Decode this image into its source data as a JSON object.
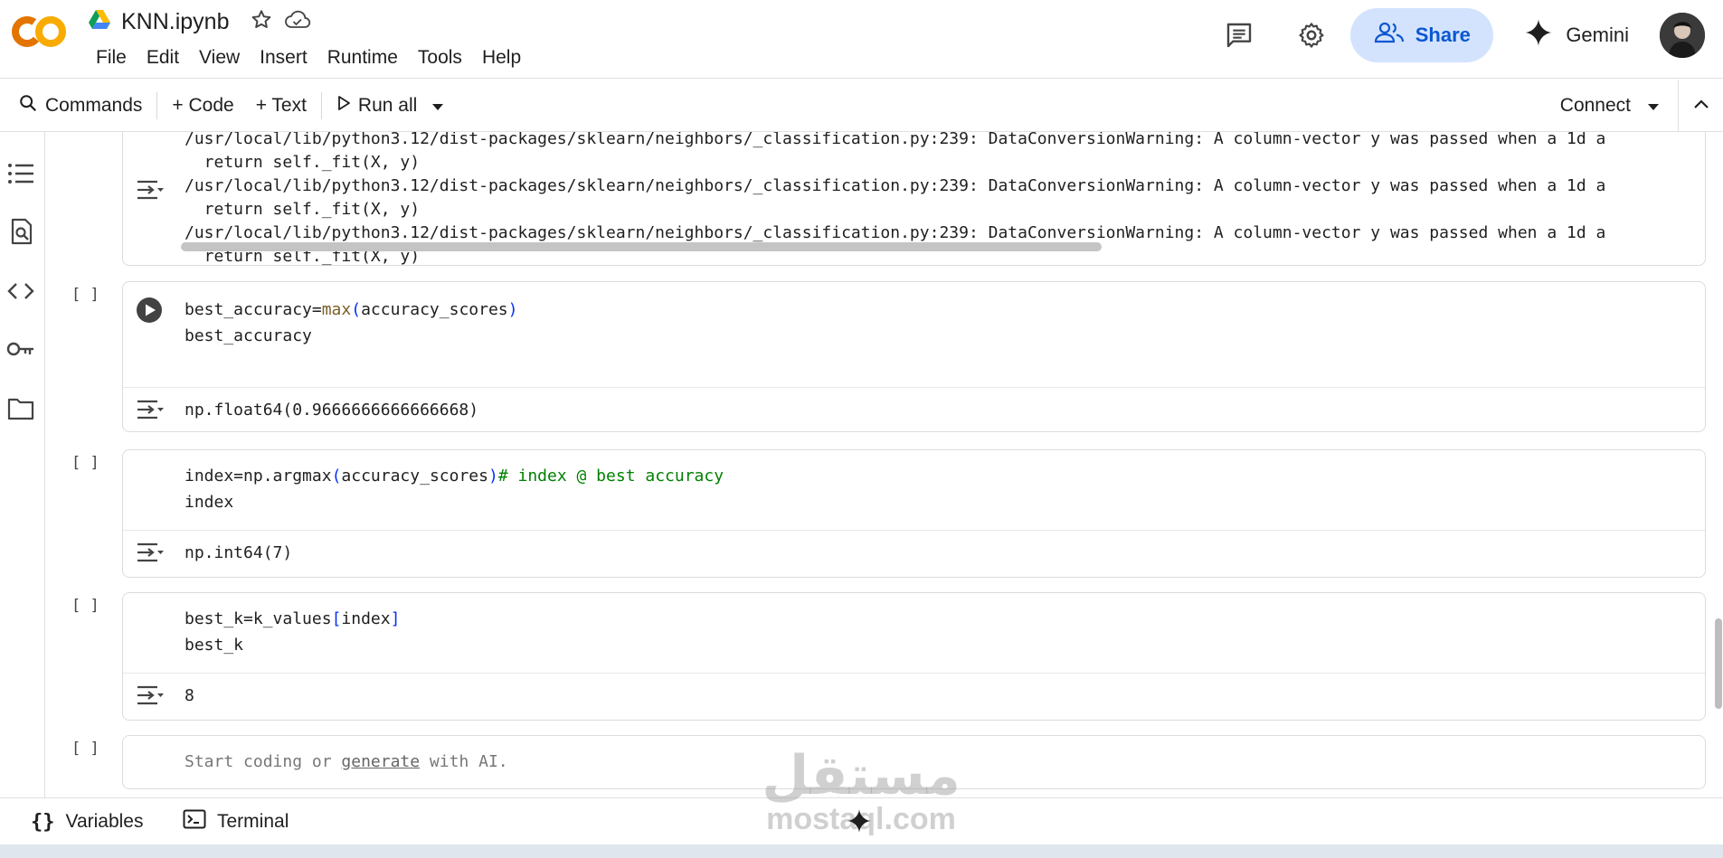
{
  "header": {
    "notebook_title": "KNN.ipynb",
    "menu": [
      "File",
      "Edit",
      "View",
      "Insert",
      "Runtime",
      "Tools",
      "Help"
    ],
    "share_label": "Share",
    "gemini_label": "Gemini"
  },
  "toolbar": {
    "commands_label": "Commands",
    "code_label": "+ Code",
    "text_label": "+ Text",
    "run_all_label": "Run all",
    "connect_label": "Connect"
  },
  "cells": {
    "prev_output": [
      "/usr/local/lib/python3.12/dist-packages/sklearn/neighbors/_classification.py:239: DataConversionWarning: A column-vector y was passed when a 1d a",
      "  return self._fit(X, y)",
      "/usr/local/lib/python3.12/dist-packages/sklearn/neighbors/_classification.py:239: DataConversionWarning: A column-vector y was passed when a 1d a",
      "  return self._fit(X, y)",
      "/usr/local/lib/python3.12/dist-packages/sklearn/neighbors/_classification.py:239: DataConversionWarning: A column-vector y was passed when a 1d a",
      "  return self._fit(X, y)"
    ],
    "cell1": {
      "bracket": "[ ]",
      "line1_a": "best_accuracy=",
      "line1_fn": "max",
      "line1_p1": "(",
      "line1_b": "accuracy_scores",
      "line1_p2": ")",
      "line2": "best_accuracy",
      "output": "np.float64(0.9666666666666668)"
    },
    "cell2": {
      "bracket": "[ ]",
      "line1_a": "index=np.argmax",
      "line1_p1": "(",
      "line1_b": "accuracy_scores",
      "line1_p2": ")",
      "line1_cmt": "# index @ best accuracy",
      "line2": "index",
      "output": "np.int64(7)"
    },
    "cell3": {
      "bracket": "[ ]",
      "line1_a": "best_k=k_values",
      "line1_p1": "[",
      "line1_b": "index",
      "line1_p2": "]",
      "line2": "best_k",
      "output": "8"
    },
    "cell4": {
      "bracket": "[ ]",
      "placeholder_a": "Start coding or ",
      "placeholder_link": "generate",
      "placeholder_b": " with AI."
    }
  },
  "bottom_bar": {
    "variables_label": "Variables",
    "terminal_label": "Terminal"
  },
  "watermark": {
    "arabic": "مستقل",
    "latin": "mostaql.com"
  },
  "colors": {
    "share_bg": "#d3e3fd",
    "share_text": "#0b57d0",
    "logo_orange": "#f9ab00",
    "logo_dark": "#e37400",
    "comment": "#008000",
    "builtin": "#795e26",
    "bracket": "#0431fa"
  }
}
